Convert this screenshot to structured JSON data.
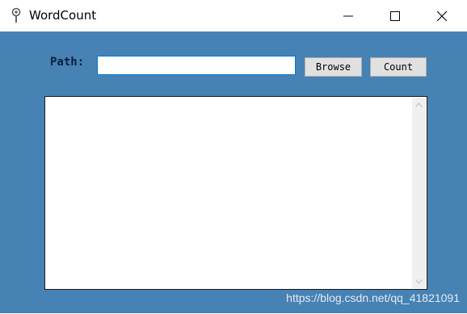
{
  "window": {
    "title": "WordCount",
    "icons": {
      "app": "pin-icon",
      "minimize": "minimize-icon",
      "maximize": "maximize-icon",
      "close": "close-icon"
    }
  },
  "form": {
    "path_label": "Path:",
    "path_value": "",
    "path_placeholder": "",
    "browse_label": "Browse",
    "count_label": "Count"
  },
  "output": {
    "text": ""
  },
  "watermark": "https://blog.csdn.net/qq_41821091",
  "colors": {
    "client_background": "#4682b4",
    "label_text": "#0a1e3c",
    "input_focus_border": "#0078d7",
    "button_background": "#e1e1e1"
  }
}
